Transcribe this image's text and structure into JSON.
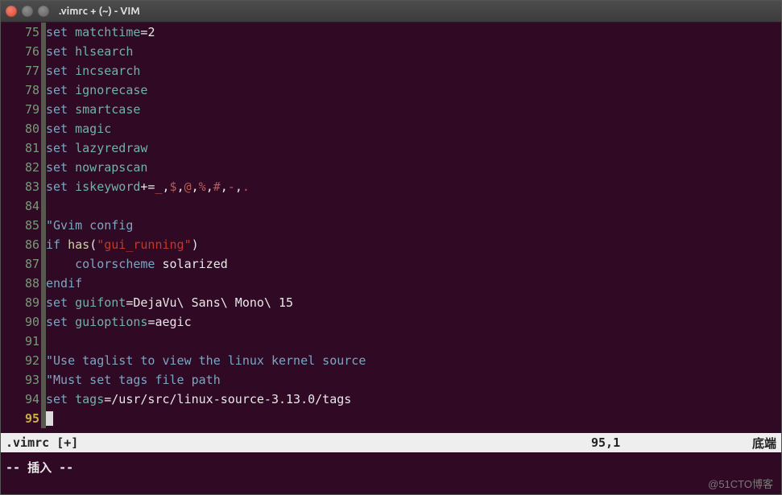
{
  "window": {
    "title": ".vimrc + (~) - VIM"
  },
  "lines": [
    {
      "n": "75",
      "tokens": [
        {
          "t": "set ",
          "c": "kw-set"
        },
        {
          "t": "matchtime",
          "c": "kw-option"
        },
        {
          "t": "=",
          "c": "plain"
        },
        {
          "t": "2",
          "c": "plain"
        }
      ]
    },
    {
      "n": "76",
      "tokens": [
        {
          "t": "set ",
          "c": "kw-set"
        },
        {
          "t": "hlsearch",
          "c": "kw-option"
        }
      ]
    },
    {
      "n": "77",
      "tokens": [
        {
          "t": "set ",
          "c": "kw-set"
        },
        {
          "t": "incsearch",
          "c": "kw-option"
        }
      ]
    },
    {
      "n": "78",
      "tokens": [
        {
          "t": "set ",
          "c": "kw-set"
        },
        {
          "t": "ignorecase",
          "c": "kw-option"
        }
      ]
    },
    {
      "n": "79",
      "tokens": [
        {
          "t": "set ",
          "c": "kw-set"
        },
        {
          "t": "smartcase",
          "c": "kw-option"
        }
      ]
    },
    {
      "n": "80",
      "tokens": [
        {
          "t": "set ",
          "c": "kw-set"
        },
        {
          "t": "magic",
          "c": "kw-option"
        }
      ]
    },
    {
      "n": "81",
      "tokens": [
        {
          "t": "set ",
          "c": "kw-set"
        },
        {
          "t": "lazyredraw",
          "c": "kw-option"
        }
      ]
    },
    {
      "n": "82",
      "tokens": [
        {
          "t": "set ",
          "c": "kw-set"
        },
        {
          "t": "nowrapscan",
          "c": "kw-option"
        }
      ]
    },
    {
      "n": "83",
      "tokens": [
        {
          "t": "set ",
          "c": "kw-set"
        },
        {
          "t": "iskeyword",
          "c": "kw-option"
        },
        {
          "t": "+=",
          "c": "plain"
        },
        {
          "t": "_",
          "c": "sym-red"
        },
        {
          "t": ",",
          "c": "plain"
        },
        {
          "t": "$",
          "c": "sym-red"
        },
        {
          "t": ",",
          "c": "plain"
        },
        {
          "t": "@",
          "c": "sym-red"
        },
        {
          "t": ",",
          "c": "plain"
        },
        {
          "t": "%",
          "c": "sym-red"
        },
        {
          "t": ",",
          "c": "plain"
        },
        {
          "t": "#",
          "c": "sym-red"
        },
        {
          "t": ",",
          "c": "plain"
        },
        {
          "t": "-",
          "c": "sym-red"
        },
        {
          "t": ",",
          "c": "plain"
        },
        {
          "t": ".",
          "c": "sym-red"
        }
      ]
    },
    {
      "n": "84",
      "tokens": []
    },
    {
      "n": "85",
      "tokens": [
        {
          "t": "\"Gvim config",
          "c": "comment"
        }
      ]
    },
    {
      "n": "86",
      "tokens": [
        {
          "t": "if ",
          "c": "statement"
        },
        {
          "t": "has",
          "c": "func"
        },
        {
          "t": "(",
          "c": "plain"
        },
        {
          "t": "\"gui_running\"",
          "c": "string"
        },
        {
          "t": ")",
          "c": "plain"
        }
      ]
    },
    {
      "n": "87",
      "tokens": [
        {
          "t": "    colorscheme ",
          "c": "kw-set"
        },
        {
          "t": "solarized",
          "c": "plain"
        }
      ]
    },
    {
      "n": "88",
      "tokens": [
        {
          "t": "endif",
          "c": "statement"
        }
      ]
    },
    {
      "n": "89",
      "tokens": [
        {
          "t": "set ",
          "c": "kw-set"
        },
        {
          "t": "guifont",
          "c": "kw-option"
        },
        {
          "t": "=DejaVu\\ Sans\\ Mono\\ 15",
          "c": "plain"
        }
      ]
    },
    {
      "n": "90",
      "tokens": [
        {
          "t": "set ",
          "c": "kw-set"
        },
        {
          "t": "guioptions",
          "c": "kw-option"
        },
        {
          "t": "=aegic",
          "c": "plain"
        }
      ]
    },
    {
      "n": "91",
      "tokens": []
    },
    {
      "n": "92",
      "tokens": [
        {
          "t": "\"Use taglist to view the linux kernel source",
          "c": "comment"
        }
      ]
    },
    {
      "n": "93",
      "tokens": [
        {
          "t": "\"Must set tags file path",
          "c": "comment"
        }
      ]
    },
    {
      "n": "94",
      "tokens": [
        {
          "t": "set ",
          "c": "kw-set"
        },
        {
          "t": "tags",
          "c": "kw-option"
        },
        {
          "t": "=/usr/src/linux-source-3.13.0/tags",
          "c": "plain"
        }
      ]
    },
    {
      "n": "95",
      "current": true,
      "tokens": [
        {
          "t": "",
          "c": "plain",
          "cursor": true
        }
      ]
    }
  ],
  "status": {
    "filename": ".vimrc [+]",
    "position": "95,1",
    "scroll": "底端"
  },
  "mode": "-- 插入 --",
  "watermark": "@51CTO博客"
}
